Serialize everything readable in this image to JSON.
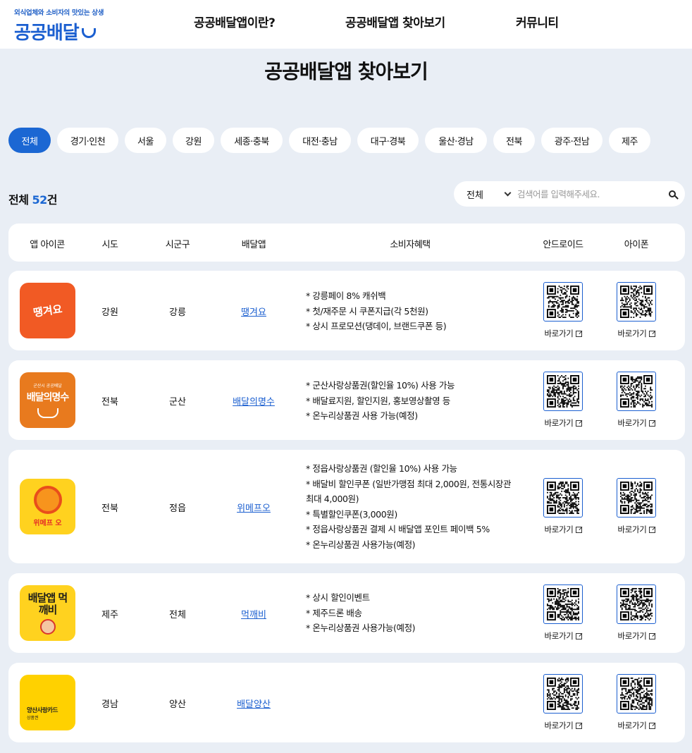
{
  "header": {
    "logo_tagline": "외식업체와 소비자의 맛있는 상생",
    "logo_text": "공공배달",
    "nav": [
      "공공배달앱이란?",
      "공공배달앱 찾아보기",
      "커뮤니티"
    ]
  },
  "page_title": "공공배달앱 찾아보기",
  "regions": [
    "전체",
    "경기·인천",
    "서울",
    "강원",
    "세종·충북",
    "대전·충남",
    "대구·경북",
    "울산·경남",
    "전북",
    "광주·전남",
    "제주"
  ],
  "active_region": "전체",
  "count": {
    "prefix": "전체",
    "number": "52",
    "suffix": "건"
  },
  "search": {
    "select_value": "전체",
    "placeholder": "검색어를 입력해주세요."
  },
  "table_headers": [
    "앱 아이콘",
    "시도",
    "시군구",
    "배달앱",
    "소비자혜택",
    "안드로이드",
    "아이폰"
  ],
  "goto_label": "바로가기",
  "rows": [
    {
      "icon_text": "땡겨요",
      "icon_bg": "#f15a24",
      "sido": "강원",
      "sigungu": "강릉",
      "app": "땡겨요",
      "benefits": [
        "* 강릉페이 8% 캐쉬백",
        "* 첫/재주문 시 쿠폰지급(각 5천원)",
        "* 상시 프로모션(댕데이, 브랜드쿠폰 등)"
      ]
    },
    {
      "icon_text": "배달의명수",
      "icon_sub": "군산시 공공배달",
      "icon_bg": "#e87a1e",
      "sido": "전북",
      "sigungu": "군산",
      "app": "배달의명수",
      "benefits": [
        "* 군산사랑상품권(할인율 10%) 사용 가능",
        "* 배달료지원, 할인지원, 홍보영상촬영 등",
        "* 온누리상품권 사용 가능(예정)"
      ]
    },
    {
      "icon_text": "위메프 오",
      "icon_bg": "#ffd21f",
      "sido": "전북",
      "sigungu": "정읍",
      "app": "위메프오",
      "benefits": [
        "* 정읍사랑상품권 (할인율 10%) 사용 가능",
        "* 배달비 할인쿠폰 (일반가맹점 최대 2,000원, 전통시장관 최대 4,000원)",
        "* 특별할인쿠폰(3,000원)",
        "* 정읍사랑상품권 결제 시 배달앱 포인트 페이백 5%",
        "* 온누리상품권 사용가능(예정)"
      ]
    },
    {
      "icon_text": "배달앱 먹깨비",
      "icon_bg": "#ffd21f",
      "sido": "제주",
      "sigungu": "전체",
      "app": "먹깨비",
      "benefits": [
        "* 상시 할인이벤트",
        "* 제주드론 배송",
        "* 온누리상품권 사용가능(예정)"
      ]
    },
    {
      "icon_text": "양산사랑카드",
      "icon_sub": "상품권",
      "icon_bg": "#ffd100",
      "sido": "경남",
      "sigungu": "양산",
      "app": "배달양산",
      "benefits": []
    }
  ]
}
